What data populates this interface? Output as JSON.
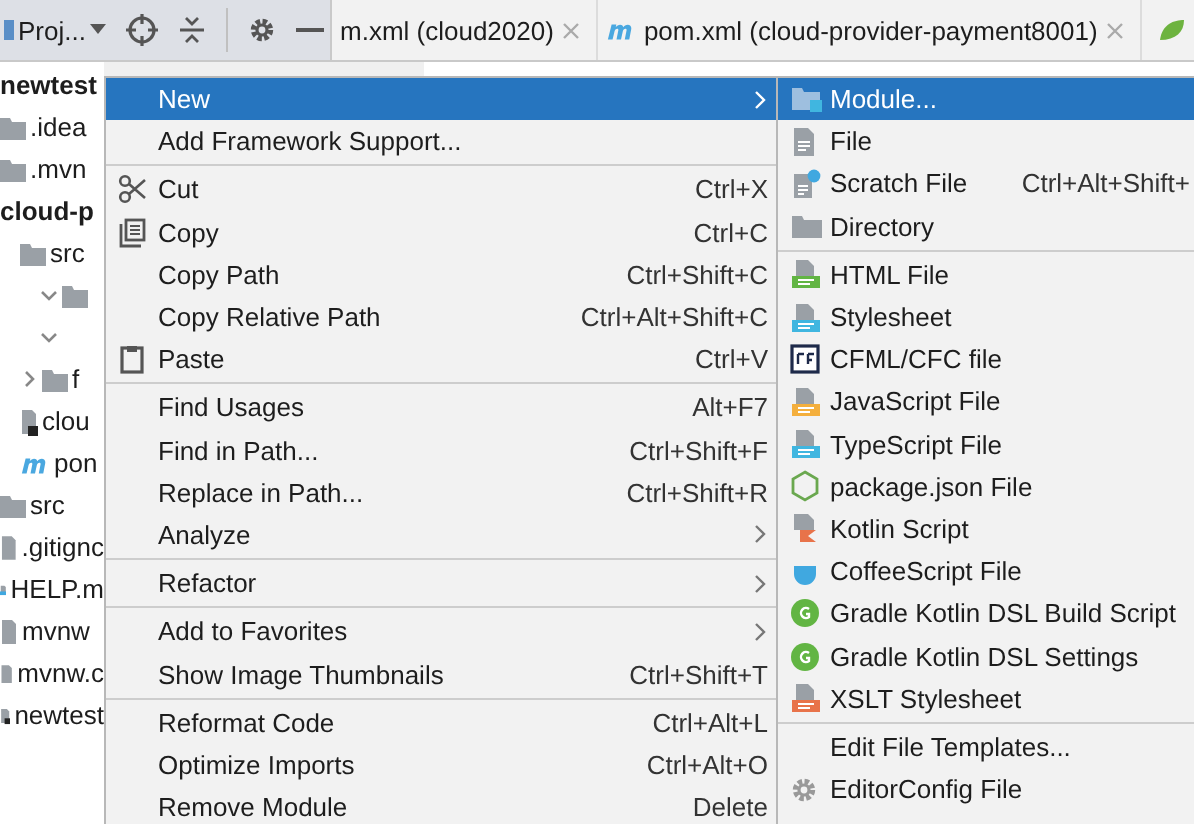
{
  "toolbar": {
    "view_label": "Proj...",
    "tabs": [
      {
        "label": "m.xml (cloud2020)",
        "kind": "plain",
        "selected": false
      },
      {
        "label": "pom.xml (cloud-provider-payment8001)",
        "kind": "maven",
        "selected": false
      }
    ]
  },
  "project_tree": [
    {
      "label": "newtest",
      "kind": "module"
    },
    {
      "label": ".idea",
      "kind": "folder"
    },
    {
      "label": ".mvn",
      "kind": "folder"
    },
    {
      "label": "cloud-p",
      "kind": "module",
      "children": [
        {
          "label": "src",
          "kind": "folder",
          "children": [
            {
              "kind": "folder-expanded"
            },
            {
              "kind": "chevron"
            }
          ]
        },
        {
          "label": "f",
          "kind": "folder-collapsed"
        },
        {
          "label": "clou",
          "kind": "iml"
        },
        {
          "label": "pon",
          "kind": "maven"
        }
      ]
    },
    {
      "label": "src",
      "kind": "folder"
    },
    {
      "label": ".gitignc",
      "kind": "ignored"
    },
    {
      "label": "HELP.m",
      "kind": "md"
    },
    {
      "label": "mvnw",
      "kind": "file"
    },
    {
      "label": "mvnw.c",
      "kind": "text"
    },
    {
      "label": "newtest",
      "kind": "iml"
    }
  ],
  "context_menu": {
    "groups": [
      [
        {
          "label": "New",
          "kind": "submenu",
          "selected": true
        },
        {
          "label": "Add Framework Support...",
          "kind": "plain",
          "selected": false
        }
      ],
      [
        {
          "label": "Cut",
          "shortcut": "Ctrl+X",
          "kind": "cut",
          "selected": false
        },
        {
          "label": "Copy",
          "shortcut": "Ctrl+C",
          "kind": "copy",
          "selected": false
        },
        {
          "label": "Copy Path",
          "shortcut": "Ctrl+Shift+C",
          "kind": "plain",
          "selected": false
        },
        {
          "label": "Copy Relative Path",
          "shortcut": "Ctrl+Alt+Shift+C",
          "kind": "plain",
          "selected": false
        },
        {
          "label": "Paste",
          "shortcut": "Ctrl+V",
          "kind": "paste",
          "selected": false
        }
      ],
      [
        {
          "label": "Find Usages",
          "shortcut": "Alt+F7",
          "kind": "plain",
          "selected": false
        },
        {
          "label": "Find in Path...",
          "shortcut": "Ctrl+Shift+F",
          "kind": "plain",
          "selected": false
        },
        {
          "label": "Replace in Path...",
          "shortcut": "Ctrl+Shift+R",
          "kind": "plain",
          "selected": false
        },
        {
          "label": "Analyze",
          "kind": "submenu",
          "selected": false
        }
      ],
      [
        {
          "label": "Refactor",
          "kind": "submenu",
          "selected": false
        }
      ],
      [
        {
          "label": "Add to Favorites",
          "kind": "submenu",
          "selected": false
        },
        {
          "label": "Show Image Thumbnails",
          "shortcut": "Ctrl+Shift+T",
          "kind": "plain",
          "selected": false
        }
      ],
      [
        {
          "label": "Reformat Code",
          "shortcut": "Ctrl+Alt+L",
          "kind": "plain",
          "selected": false
        },
        {
          "label": "Optimize Imports",
          "shortcut": "Ctrl+Alt+O",
          "kind": "plain",
          "selected": false
        },
        {
          "label": "Remove Module",
          "shortcut": "Delete",
          "kind": "plain",
          "selected": false
        }
      ]
    ]
  },
  "new_submenu": {
    "groups": [
      [
        {
          "label": "Module...",
          "kind": "module",
          "selected": true
        },
        {
          "label": "File",
          "kind": "file",
          "selected": false
        },
        {
          "label": "Scratch File",
          "shortcut": "Ctrl+Alt+Shift+",
          "kind": "scratch",
          "selected": false
        },
        {
          "label": "Directory",
          "kind": "directory",
          "selected": false
        }
      ],
      [
        {
          "label": "HTML File",
          "kind": "html",
          "selected": false
        },
        {
          "label": "Stylesheet",
          "kind": "css",
          "selected": false
        },
        {
          "label": "CFML/CFC file",
          "kind": "cfml",
          "selected": false
        },
        {
          "label": "JavaScript File",
          "kind": "js",
          "selected": false
        },
        {
          "label": "TypeScript File",
          "kind": "ts",
          "selected": false
        },
        {
          "label": "package.json File",
          "kind": "npm",
          "selected": false
        },
        {
          "label": "Kotlin Script",
          "kind": "kotlin",
          "selected": false
        },
        {
          "label": "CoffeeScript File",
          "kind": "coffee",
          "selected": false
        },
        {
          "label": "Gradle Kotlin DSL Build Script",
          "kind": "gradle",
          "selected": false
        },
        {
          "label": "Gradle Kotlin DSL Settings",
          "kind": "gradle",
          "selected": false
        },
        {
          "label": "XSLT Stylesheet",
          "kind": "xslt",
          "selected": false
        }
      ],
      [
        {
          "label": "Edit File Templates...",
          "kind": "plain",
          "selected": false
        },
        {
          "label": "EditorConfig File",
          "kind": "gear",
          "selected": false
        }
      ]
    ]
  }
}
